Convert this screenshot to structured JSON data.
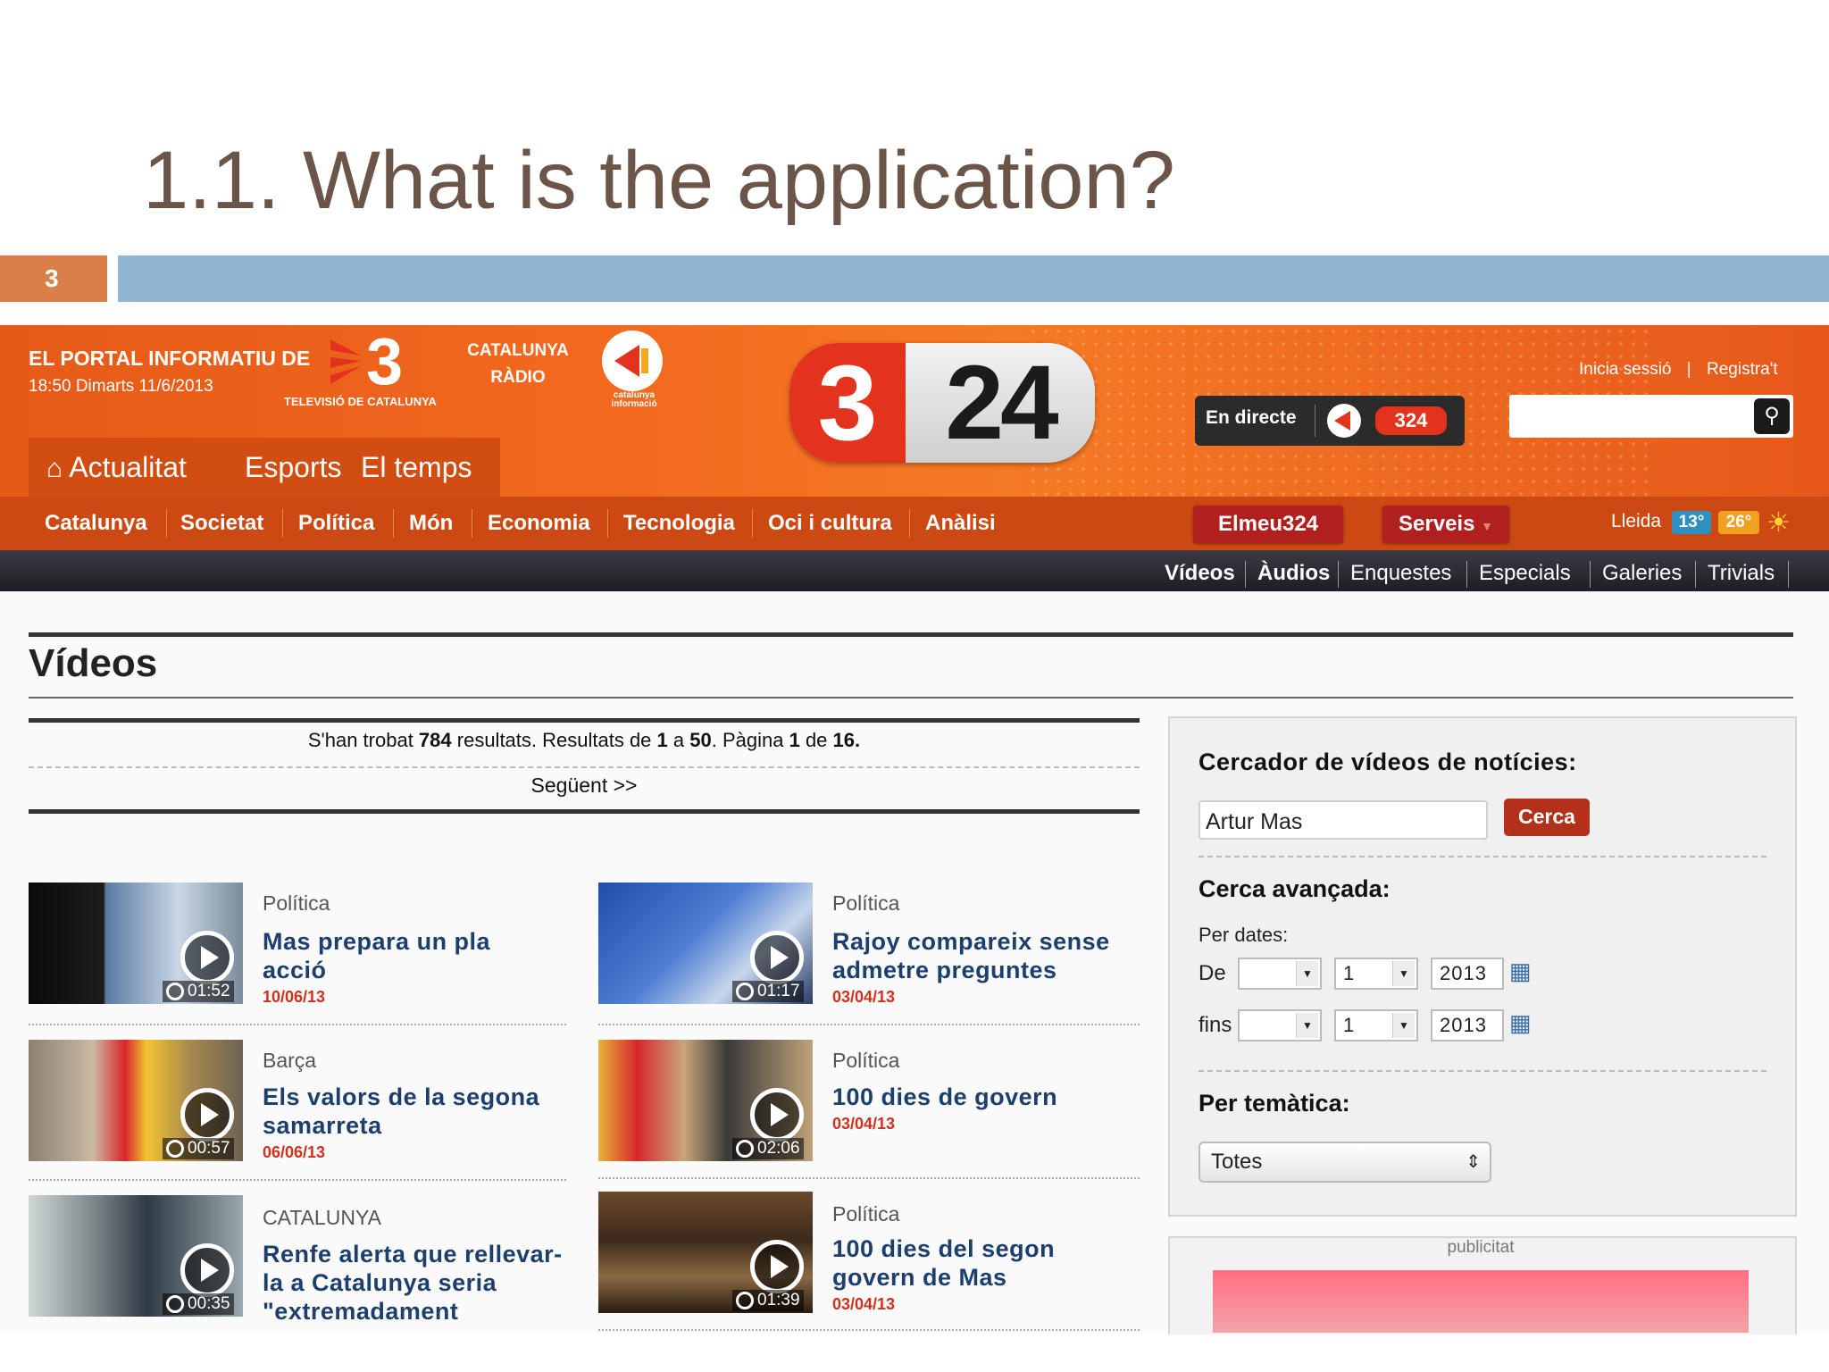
{
  "slide": {
    "title": "1.1. What is the application?",
    "number": "3"
  },
  "header": {
    "portal": "EL PORTAL INFORMATIU DE",
    "datetime": "18:50 Dimarts 11/6/2013",
    "tv3_caption": "TELEVISIÓ DE CATALUNYA",
    "radio_line1": "CATALUNYA",
    "radio_line2": "RÀDIO",
    "ci_caption": "catalunya informació",
    "logo_3": "3",
    "logo_24": "24",
    "live_label": "En directe",
    "live_badge": "324",
    "login": "Inicia sessió",
    "register": "Registra't",
    "tabs": [
      "Actualitat",
      "Esports",
      "El temps"
    ]
  },
  "nav": {
    "items": [
      "Catalunya",
      "Societat",
      "Política",
      "Món",
      "Economia",
      "Tecnologia",
      "Oci i cultura",
      "Anàlisi"
    ],
    "elmeu": "Elmeu324",
    "serveis": "Serveis",
    "city": "Lleida",
    "temp_min": "13°",
    "temp_max": "26°",
    "accent": "#cc4913"
  },
  "subnav": {
    "items": [
      "Vídeos",
      "Àudios",
      "Enquestes",
      "Especials",
      "Galeries",
      "Trivials"
    ]
  },
  "videos": {
    "heading": "Vídeos",
    "results_prefix": "S'han trobat ",
    "results_total": "784",
    "results_mid1": " resultats. Resultats de ",
    "results_from": "1",
    "results_mid2": " a ",
    "results_to": "50",
    "results_mid3": ". Pàgina ",
    "results_page": "1",
    "results_mid4": " de ",
    "results_pages": "16.",
    "next": "Següent >>",
    "cards": [
      {
        "category": "Política",
        "title": "Mas prepara un pla acció",
        "date": "10/06/13",
        "duration": "01:52"
      },
      {
        "category": "Política",
        "title": "Rajoy compareix sense admetre preguntes",
        "date": "03/04/13",
        "duration": "01:17"
      },
      {
        "category": "Barça",
        "title": "Els valors de la segona samarreta",
        "date": "06/06/13",
        "duration": "00:57"
      },
      {
        "category": "Política",
        "title": "100 dies de govern",
        "date": "03/04/13",
        "duration": "02:06"
      },
      {
        "category": "CATALUNYA",
        "title": "Renfe alerta que rellevar-la a Catalunya seria \"extremadament",
        "date": "",
        "duration": "00:35"
      },
      {
        "category": "Política",
        "title": "100 dies del segon govern de Mas",
        "date": "03/04/13",
        "duration": "01:39"
      }
    ]
  },
  "sidebar": {
    "heading": "Cercador de vídeos de notícies:",
    "search_value": "Artur Mas",
    "search_button": "Cerca",
    "advanced": "Cerca avançada:",
    "by_dates": "Per dates:",
    "from_label": "De",
    "to_label": "fins",
    "day_value": "1",
    "year_value": "2013",
    "by_topic": "Per temàtica:",
    "topic_value": "Totes",
    "ad_label": "publicitat"
  }
}
